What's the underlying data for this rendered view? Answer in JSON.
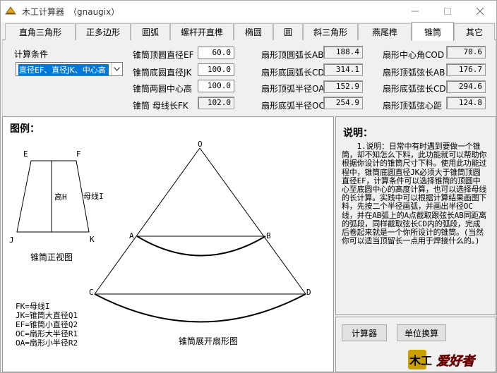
{
  "window": {
    "title": "木工计算器　（gnaugix）",
    "buttons": [
      "minimize-icon",
      "maximize-icon",
      "close-icon"
    ]
  },
  "tabs": [
    {
      "label": "直角三角形"
    },
    {
      "label": "正多边形"
    },
    {
      "label": "圆弧"
    },
    {
      "label": "螺杆开直榫"
    },
    {
      "label": "椭圆"
    },
    {
      "label": "圆"
    },
    {
      "label": "斜三角形"
    },
    {
      "label": "燕尾榫"
    },
    {
      "label": "锥筒",
      "active": true
    },
    {
      "label": "其它"
    }
  ],
  "calc": {
    "condition_label": "计算条件",
    "condition_value": "直径EF、直径JK、中心高"
  },
  "inputs": [
    {
      "label": "锥筒顶圆直径EF",
      "value": "60.0"
    },
    {
      "label": "锥筒底圆直径JK",
      "value": "100.0"
    },
    {
      "label": "锥筒两圆中心高",
      "value": "100.0"
    },
    {
      "label": "锥筒 母线长FK",
      "value": "102.0"
    }
  ],
  "results_mid": [
    {
      "label": "扇形顶圆弧长AB",
      "value": "188.4"
    },
    {
      "label": "扇形底圆弧长CD",
      "value": "314.1"
    },
    {
      "label": "扇形顶弧半径OA",
      "value": "152.9"
    },
    {
      "label": "扇形底弧半径OC",
      "value": "254.9"
    }
  ],
  "results_right": [
    {
      "label": "扇形中心角COD",
      "value": "70.6"
    },
    {
      "label": "扇形顶弧弦长AB",
      "value": "176.7"
    },
    {
      "label": "扇形底弧弦长CD",
      "value": "294.6"
    },
    {
      "label": "扇形顶弧弦心距",
      "value": "124.8"
    }
  ],
  "diagram": {
    "title": "图例：",
    "front_caption": "锥筒正视图",
    "fan_caption": "锥筒展开扇形图",
    "labels": {
      "E": "E",
      "F": "F",
      "J": "J",
      "K": "K",
      "H": "高H",
      "I": "母线I",
      "O": "O",
      "A": "A",
      "B": "B",
      "C": "C",
      "D": "D"
    },
    "legend": [
      "FK=母线I",
      "JK=锥筒大直径Q1",
      "EF=锥筒小直径Q2",
      "OC=扇形大半径R1",
      "OA=扇形小半径R2"
    ]
  },
  "explain": {
    "title": "说明：",
    "text": "　　1.说明：日常中有时遇到要做一个锥筒，却不知怎么下料，此功能就可以帮助你根据你设计的锥筒尺寸下料。使用此功能过程中，锥筒底圆直径JK必须大于锥筒顶圆直径EF，计算条件可以选择锥筒的顶圆中心至底圆中心的高度计算，也可以选择母线的长计算。实践中可以根据计算结果画图下料，先按二个半径画弧，并画出半径OC线，并在AB弧上的A点截取跟弦长AB同距离的弧段，同样截取弦长CD内的弧段，完成后卷起来就是一个你所设计的锥筒。(当然你可以适当顶留长一点用于焊接什么的。)"
  },
  "buttons": {
    "calc": "计算器",
    "unit": "单位换算"
  },
  "logo": {
    "text": "爱好者",
    "prefix": "木工"
  }
}
